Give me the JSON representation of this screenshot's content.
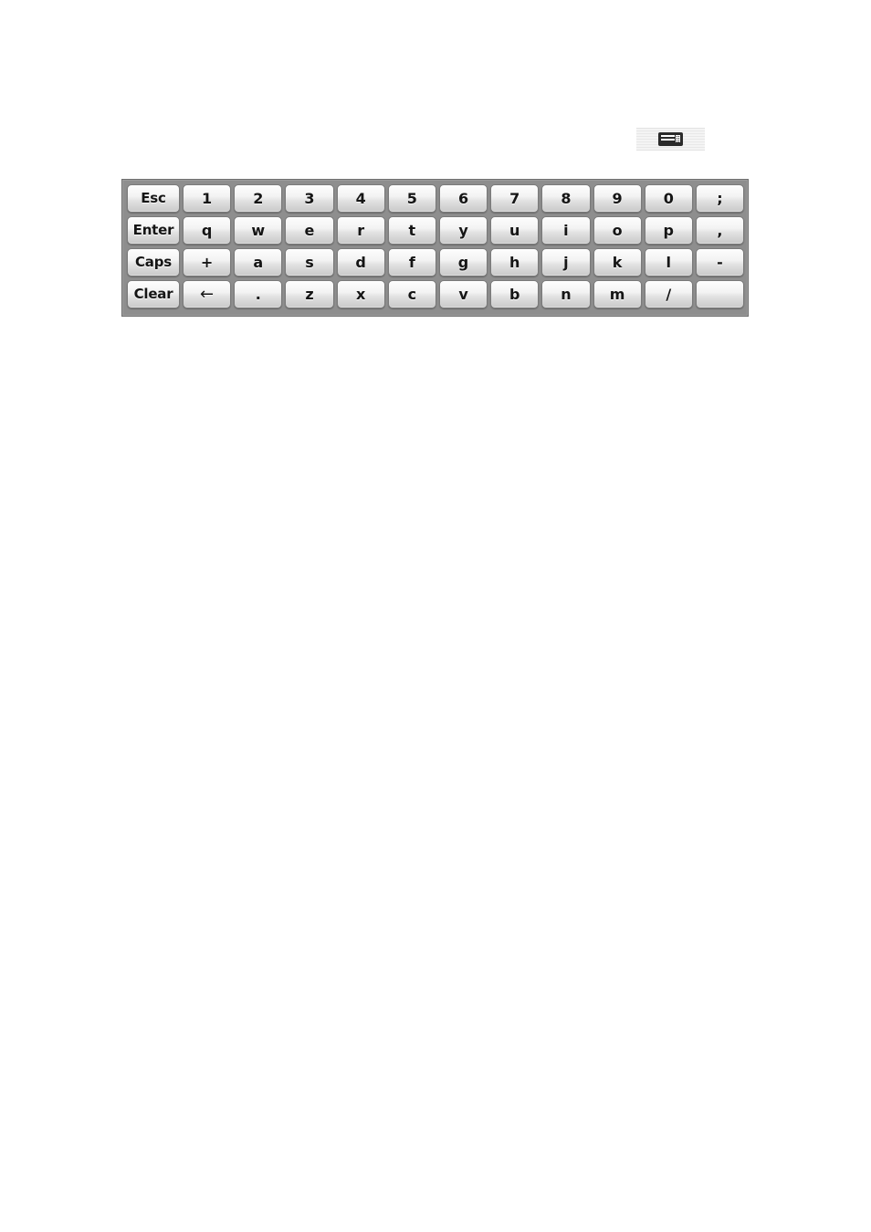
{
  "toolbar": {
    "keyboard_toggle": {
      "icon": "keyboard-icon",
      "label": ""
    }
  },
  "keyboard": {
    "name": "on-screen-keyboard",
    "colors": {
      "panel_background": "#8e8e8e",
      "panel_border": "#6f6f6f",
      "key_top": "#fdfdfd",
      "key_bottom": "#c9c9c9",
      "key_border": "#7a7a7a",
      "key_text": "#151515",
      "page_background": "#ffffff"
    },
    "rows": [
      {
        "modifier": "Esc",
        "keys": [
          "1",
          "2",
          "3",
          "4",
          "5",
          "6",
          "7",
          "8",
          "9",
          "0",
          ";"
        ]
      },
      {
        "modifier": "Enter",
        "keys": [
          "q",
          "w",
          "e",
          "r",
          "t",
          "y",
          "u",
          "i",
          "o",
          "p",
          ","
        ]
      },
      {
        "modifier": "Caps",
        "keys": [
          "+",
          "a",
          "s",
          "d",
          "f",
          "g",
          "h",
          "j",
          "k",
          "l",
          "-"
        ]
      },
      {
        "modifier": "Clear",
        "keys": [
          "←",
          ".",
          "z",
          "x",
          "c",
          "v",
          "b",
          "n",
          "m",
          "/",
          ""
        ]
      }
    ]
  }
}
